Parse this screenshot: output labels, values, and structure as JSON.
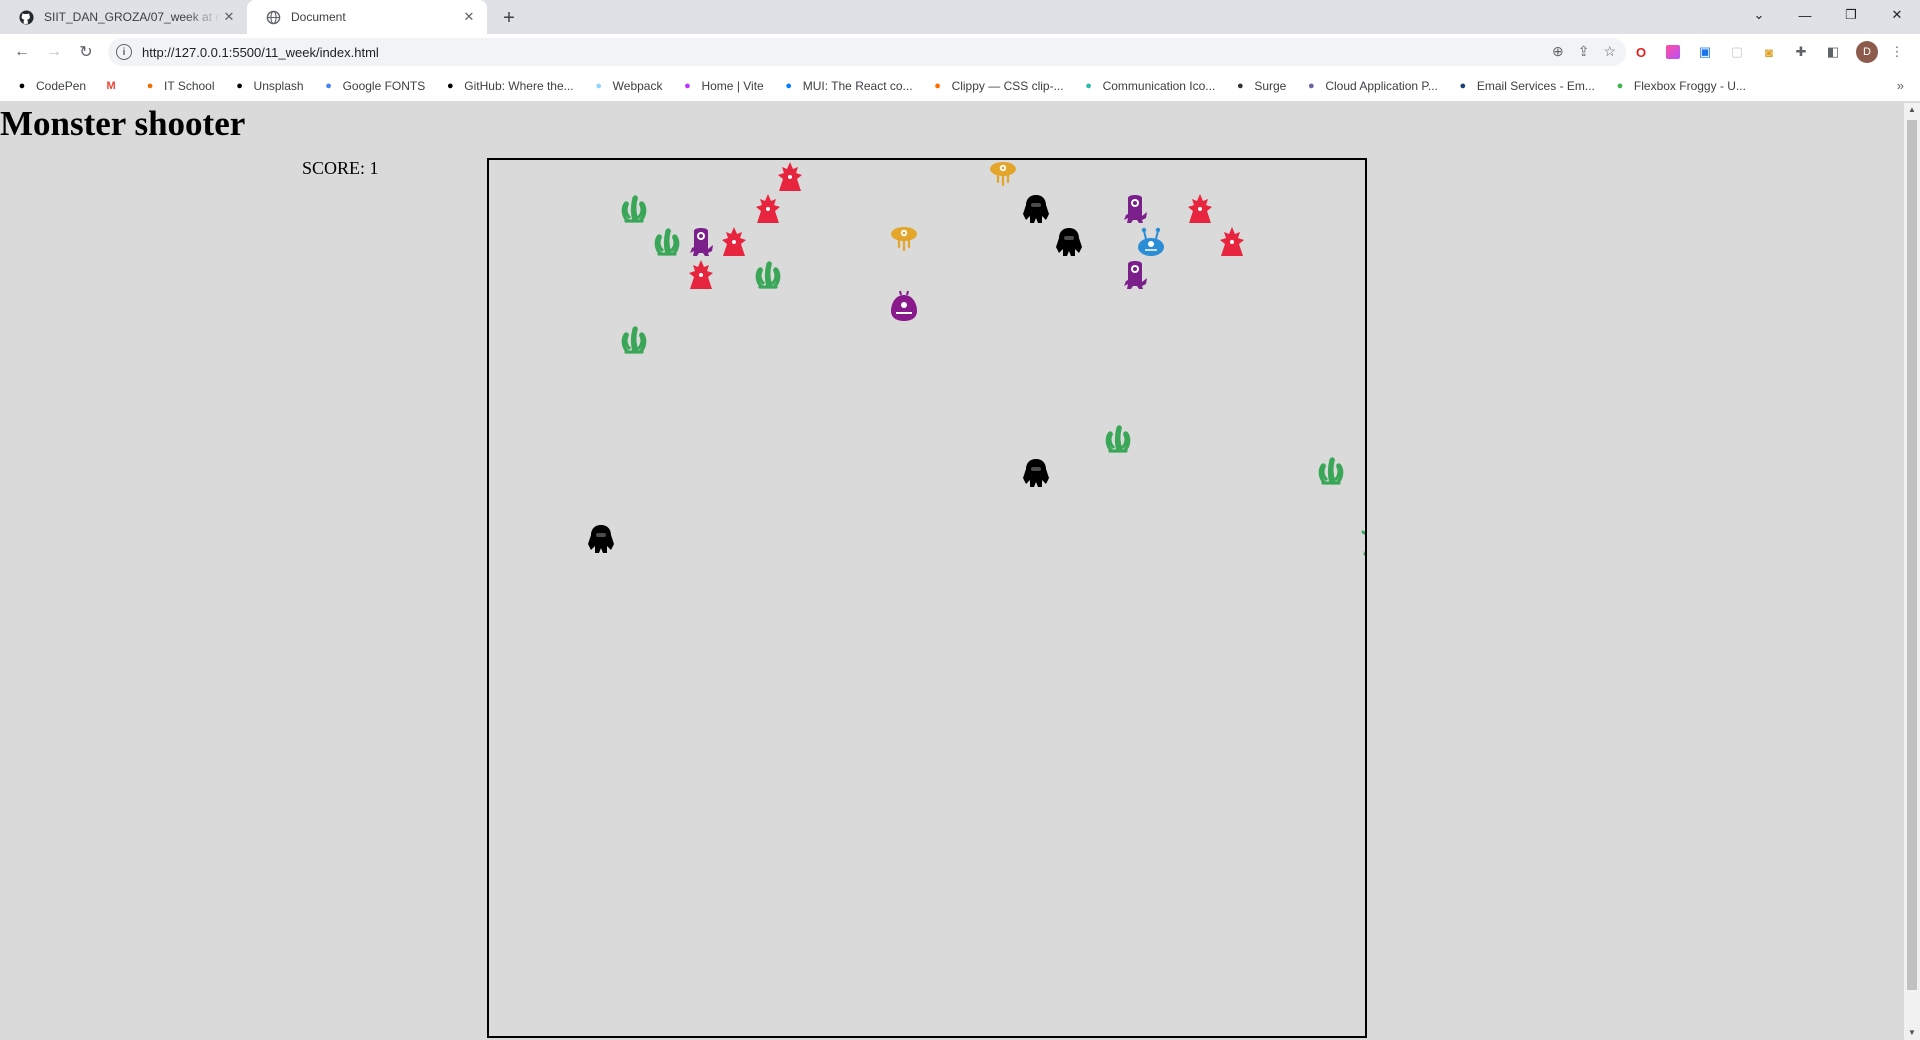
{
  "browser": {
    "tabs": [
      {
        "title": "SIIT_DAN_GROZA/07_week at ma",
        "icon": "github-icon"
      },
      {
        "title": "Document",
        "icon": "globe-icon"
      }
    ],
    "url": "http://127.0.0.1:5500/11_week/index.html",
    "profile_initial": "D",
    "bookmarks": [
      {
        "label": "CodePen",
        "icon": "codepen-icon",
        "color": "#000000"
      },
      {
        "label": "",
        "icon": "gmail-icon",
        "color": "#ea4335"
      },
      {
        "label": "IT School",
        "icon": "itschool-icon",
        "color": "#e8710a"
      },
      {
        "label": "Unsplash",
        "icon": "unsplash-icon",
        "color": "#000000"
      },
      {
        "label": "Google FONTS",
        "icon": "google-fonts-icon",
        "color": "#4285f4"
      },
      {
        "label": "GitHub: Where the...",
        "icon": "github-icon",
        "color": "#000000"
      },
      {
        "label": "Webpack",
        "icon": "webpack-icon",
        "color": "#8ed6fb"
      },
      {
        "label": "Home | Vite",
        "icon": "vite-icon",
        "color": "#bd34fe"
      },
      {
        "label": "MUI: The React co...",
        "icon": "mui-icon",
        "color": "#007fff"
      },
      {
        "label": "Clippy — CSS clip-...",
        "icon": "clippy-icon",
        "color": "#ff6f00"
      },
      {
        "label": "Communication Ico...",
        "icon": "communication-icon",
        "color": "#2bbbad"
      },
      {
        "label": "Surge",
        "icon": "surge-icon",
        "color": "#333333"
      },
      {
        "label": "Cloud Application P...",
        "icon": "heroku-icon",
        "color": "#6762a6"
      },
      {
        "label": "Email Services - Em...",
        "icon": "email-services-icon",
        "color": "#1a3d7c"
      },
      {
        "label": "Flexbox Froggy - U...",
        "icon": "froggy-icon",
        "color": "#3cb54a"
      }
    ]
  },
  "page": {
    "title": "Monster shooter",
    "score_text": "SCORE: 1"
  },
  "game": {
    "monsters": [
      {
        "kind": "red-spike",
        "color": "#e8253e"
      },
      {
        "kind": "yellow-cyclops",
        "color": "#e3a62a"
      },
      {
        "kind": "blue-tentacle",
        "color": "#2b8dd6"
      },
      {
        "kind": "green-tentacle",
        "color": "#3aa657"
      },
      {
        "kind": "red-spike",
        "color": "#e8253e"
      },
      {
        "kind": "black-gorilla",
        "color": "#000000"
      },
      {
        "kind": "purple-cyclops",
        "color": "#7b1f8a"
      },
      {
        "kind": "red-spike",
        "color": "#e8253e"
      },
      {
        "kind": "green-tentacle",
        "color": "#3aa657"
      },
      {
        "kind": "purple-cyclops",
        "color": "#7b1f8a"
      },
      {
        "kind": "red-spike",
        "color": "#e8253e"
      },
      {
        "kind": "yellow-cyclops",
        "color": "#e3a62a"
      },
      {
        "kind": "black-gorilla",
        "color": "#000000"
      },
      {
        "kind": "blue-antenna",
        "color": "#2b8dd6"
      },
      {
        "kind": "red-spike",
        "color": "#e8253e"
      },
      {
        "kind": "red-spike",
        "color": "#e8253e"
      },
      {
        "kind": "green-tentacle",
        "color": "#3aa657"
      },
      {
        "kind": "purple-cyclops",
        "color": "#7b1f8a"
      },
      {
        "kind": "purple-blob",
        "color": "#8a1a8c"
      },
      {
        "kind": "green-tentacle",
        "color": "#3aa657"
      },
      {
        "kind": "green-tentacle",
        "color": "#3aa657"
      },
      {
        "kind": "black-gorilla",
        "color": "#000000"
      },
      {
        "kind": "green-tentacle",
        "color": "#3aa657"
      },
      {
        "kind": "black-gorilla",
        "color": "#000000"
      },
      {
        "kind": "green-creature",
        "color": "#3aa657"
      }
    ]
  }
}
